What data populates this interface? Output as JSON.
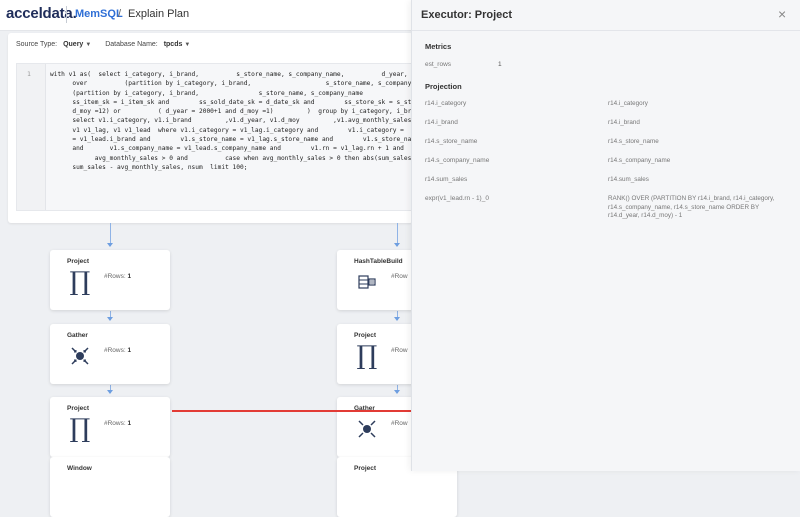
{
  "header": {
    "logo": "acceldata.",
    "app": "MemSQL",
    "separator": "/",
    "page": "Explain Plan"
  },
  "filters": {
    "source_type_label": "Source Type:",
    "source_type_value": "Query",
    "database_label": "Database Name:",
    "database_value": "tpcds"
  },
  "editor": {
    "line_number": "1",
    "sql": "with v1 as(  select i_category, i_brand,          s_store_name, s_company_name,          d_year,\n      over          (partition by i_category, i_brand,                    s_store_name, s_company_name,\n      (partition by i_category, i_brand,                s_store_name, s_company_name\n      ss_item_sk = i_item_sk and        ss_sold_date_sk = d_date_sk and        ss_store_sk = s_store_sk\n      d_moy =12) or          ( d_year = 2000+1 and d_moy =1)         )  group by i_category, i_brand,\n      select v1.i_category, v1.i_brand         ,v1.d_year, v1.d_moy         ,v1.avg_monthly_sales\n      v1 v1_lag, v1 v1_lead  where v1.i_category = v1_lag.i_category and        v1.i_category =\n      = v1_lead.i_brand and        v1.s_store_name = v1_lag.s_store_name and        v1.s_store_name =\n      and       v1.s_company_name = v1_lead.s_company_name and        v1.rn = v1_lag.rn + 1 and\n            avg_monthly_sales > 0 and          case when avg_monthly_sales > 0 then abs(sum_sales\n      sum_sales - avg_monthly_sales, nsum  limit 100;"
  },
  "plan": {
    "rows_label": "#Rows:",
    "rows_label_truncated": "#Row",
    "left_nodes": [
      {
        "title": "Project",
        "rows": "1"
      },
      {
        "title": "Gather",
        "rows": "1"
      },
      {
        "title": "Project",
        "rows": "1"
      },
      {
        "title": "Window"
      }
    ],
    "right_nodes": [
      {
        "title": "HashTableBuild"
      },
      {
        "title": "Project"
      },
      {
        "title": "Gather"
      },
      {
        "title": "Project"
      }
    ]
  },
  "panel": {
    "title": "Executor: Project",
    "close": "×",
    "metrics_title": "Metrics",
    "metrics": [
      {
        "key": "est_rows",
        "value": "1"
      }
    ],
    "projection_title": "Projection",
    "projection": [
      {
        "key": "r14.i_category",
        "value": "r14.i_category"
      },
      {
        "key": "r14.i_brand",
        "value": "r14.i_brand"
      },
      {
        "key": "r14.s_store_name",
        "value": "r14.s_store_name"
      },
      {
        "key": "r14.s_company_name",
        "value": "r14.s_company_name"
      },
      {
        "key": "r14.sum_sales",
        "value": "r14.sum_sales"
      },
      {
        "key": "expr(v1_lead.rn - 1)_0",
        "value": "RANK() OVER (PARTITION BY r14.i_brand, r14.i_category, r14.s_company_name, r14.s_store_name ORDER BY r14.d_year, r14.d_moy) - 1"
      }
    ]
  },
  "colors": {
    "brand": "#1f2d5a",
    "accent": "#2f6fd6",
    "connector": "#8fb3e6",
    "highlight_arrow": "#e23b35",
    "sql_keyword": "#a626a4"
  }
}
